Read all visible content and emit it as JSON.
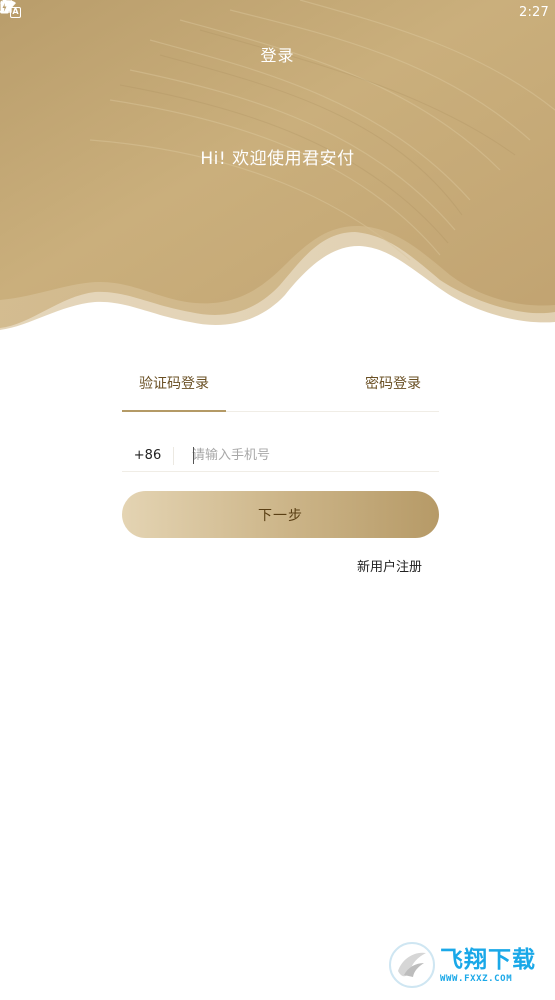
{
  "status_bar": {
    "left_icon": "A",
    "time": "2:27",
    "icons": [
      "wifi-icon",
      "no-signal-icon",
      "battery-charging-icon"
    ]
  },
  "header": {
    "title": "登录",
    "greeting": "Hi! 欢迎使用君安付"
  },
  "tabs": [
    {
      "label": "验证码登录",
      "active": true
    },
    {
      "label": "密码登录",
      "active": false
    }
  ],
  "phone": {
    "country_code": "+86",
    "value": "",
    "placeholder": "请输入手机号"
  },
  "next_button": {
    "label": "下一步"
  },
  "register_link": {
    "label": "新用户注册"
  },
  "watermark": {
    "name": "飞翔下载",
    "url": "WWW.FXXZ.COM"
  },
  "colors": {
    "gold_dark": "#b69a67",
    "gold_light": "#e4d4b3",
    "tab_text": "#6a5024",
    "button_text": "#5a3f14",
    "watermark": "#1aa8e8"
  }
}
